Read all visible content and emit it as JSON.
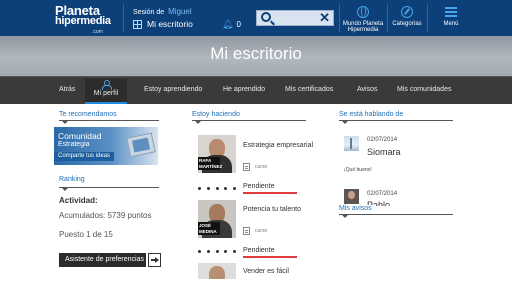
{
  "header": {
    "logo_line1": "Planeta",
    "logo_line2": "hipermedia",
    "logo_suffix": ".com",
    "session_label": "Sesión de",
    "user_name": "Miguel",
    "desk_label": "Mi escritorio",
    "notifications_count": "0",
    "search": {
      "value": "",
      "placeholder": ""
    },
    "nav": [
      {
        "label": "Mundo Planeta Hipermedia",
        "icon": "globe-icon"
      },
      {
        "label": "Categorías",
        "icon": "compass-icon"
      },
      {
        "label": "Menú",
        "icon": "menu-icon"
      }
    ]
  },
  "hero": {
    "title": "Mi escritorio"
  },
  "tabs": {
    "back": "Atrás",
    "items": [
      "Mi perfil",
      "Estoy aprendiendo",
      "He aprendido",
      "Mis certificados",
      "Avisos",
      "Mis comunidades"
    ],
    "active": "Mi perfil"
  },
  "left": {
    "section_title": "Te recomendamos",
    "promo": {
      "title": "Comunidad",
      "subtitle": "Estrategia",
      "cta": "Comparte tus ideas"
    },
    "ranking": {
      "title": "Ranking",
      "activity_label": "Actividad:",
      "accumulated": "Acumulados: 5739 puntos",
      "position": "Puesto 1 de 15"
    },
    "preferences_button": "Asistente de preferencias"
  },
  "middle": {
    "section_title": "Estoy haciendo",
    "courses": [
      {
        "name": "Estrategia empresarial",
        "type": "curso",
        "status": "Pendiente",
        "tag": "RAFA MARTÍNEZ"
      },
      {
        "name": "Potencia tu talento",
        "type": "curso",
        "status": "Pendiente",
        "tag": "JOSÉ MEDINA"
      },
      {
        "name": "Vender es fácil",
        "type": "",
        "status": "",
        "tag": ""
      }
    ],
    "status_color": "#e03a3a"
  },
  "right": {
    "section_title": "Se está hablando de",
    "chats": [
      {
        "date": "02/07/2014",
        "name": "Siomara",
        "message": "¡Qué bueno!"
      },
      {
        "date": "02/07/2014",
        "name": "Pablo",
        "message": ""
      }
    ],
    "notices_title": "Mis avisos"
  },
  "colors": {
    "topbar": "#0d3f78",
    "accent": "#1f8be0",
    "link": "#1f6fb8",
    "tabbar": "#3a3a3a"
  }
}
